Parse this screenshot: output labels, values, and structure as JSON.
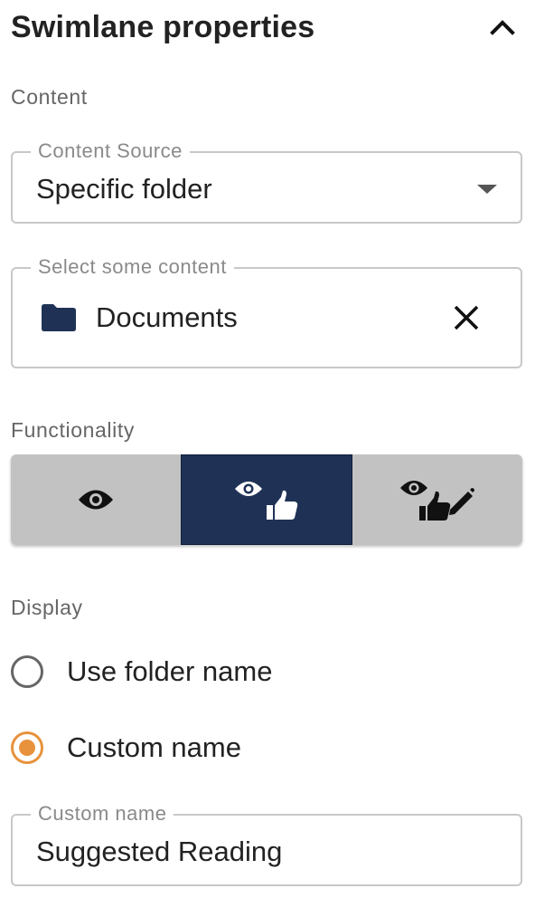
{
  "header": {
    "title": "Swimlane properties",
    "collapse_icon": "chevron-up-icon"
  },
  "content_section": {
    "label": "Content",
    "content_source": {
      "legend": "Content Source",
      "value": "Specific folder"
    },
    "select_content": {
      "legend": "Select some content",
      "item_label": "Documents",
      "item_icon": "folder-icon",
      "clear_icon": "close-icon"
    }
  },
  "functionality": {
    "label": "Functionality",
    "options": [
      {
        "icon": "eye-icon",
        "selected": false
      },
      {
        "icon": "eye-thumbs-up-icon",
        "selected": true
      },
      {
        "icon": "eye-thumbs-up-pencil-icon",
        "selected": false
      }
    ]
  },
  "display": {
    "label": "Display",
    "options": [
      {
        "label": "Use folder name",
        "checked": false
      },
      {
        "label": "Custom name",
        "checked": true
      }
    ],
    "custom_name": {
      "legend": "Custom name",
      "value": "Suggested Reading"
    }
  },
  "colors": {
    "accent": "#e8923d",
    "selected_segment": "#1f3256",
    "segment_bg": "#c2c2c2",
    "folder": "#1f3256"
  }
}
